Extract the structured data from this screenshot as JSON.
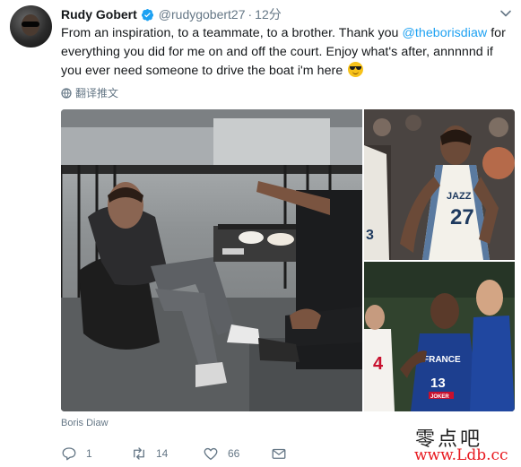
{
  "tweet": {
    "author_name": "Rudy Gobert",
    "handle": "@rudygobert27",
    "separator": "·",
    "time": "12分",
    "text_before": "From an inspiration, to a teammate, to a brother. Thank you ",
    "mention": "@theborisdiaw",
    "text_after": "  for everything you did for me on and off the court. Enjoy what's after, annnnnd if you ever need someone to drive the boat i'm here ",
    "emoji": "smiling-face-with-sunglasses",
    "translate_label": "翻译推文",
    "media_caption": "Boris Diaw"
  },
  "jersey_text": {
    "jazz_wordmark": "JAZZ",
    "jazz_number": "27",
    "left_player_number": "3",
    "france_wordmark": "FRANCE",
    "france_number": "13",
    "france_sponsor": "JOKER",
    "spain_number": "4"
  },
  "actions": {
    "reply_count": "1",
    "retweet_count": "14",
    "like_count": "66"
  },
  "watermark": {
    "chinese": "零点吧",
    "url": "www.Ldb.cc"
  },
  "colors": {
    "text": "#14171a",
    "secondary": "#657786",
    "link": "#1da1f2",
    "verified": "#1da1f2",
    "watermark_url": "#e8191f"
  },
  "icons": [
    "verified-badge-icon",
    "chevron-down-icon",
    "globe-icon",
    "reply-icon",
    "retweet-icon",
    "like-icon",
    "mail-icon"
  ]
}
